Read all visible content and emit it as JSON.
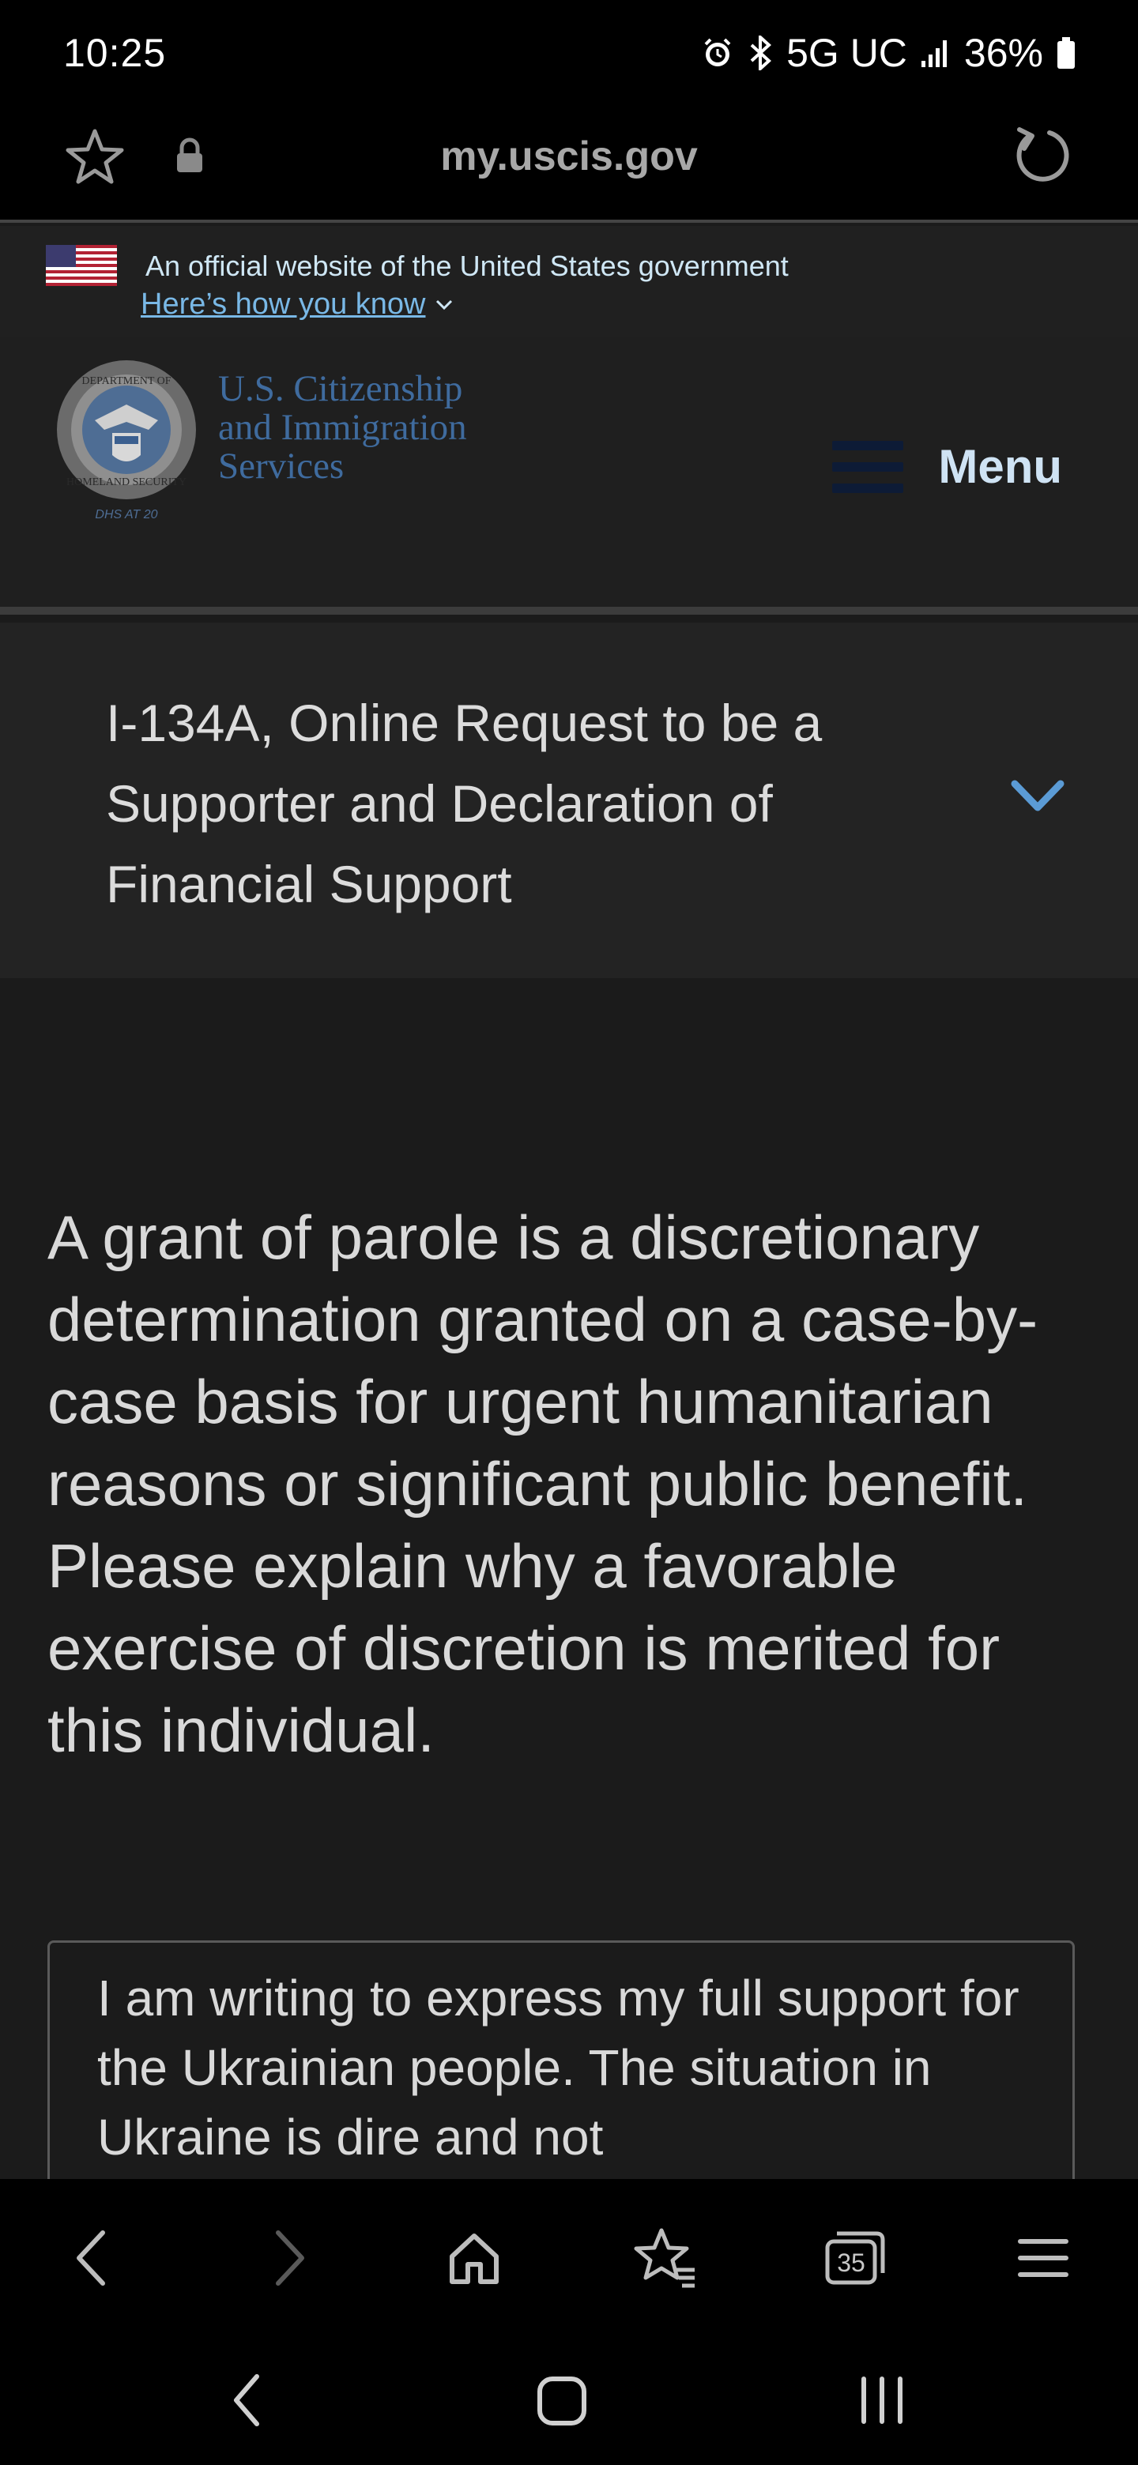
{
  "status_bar": {
    "time": "10:25",
    "network": "5G UC",
    "battery": "36%",
    "icons": [
      "alarm-icon",
      "bluetooth-icon",
      "signal-icon",
      "battery-icon"
    ]
  },
  "browser": {
    "url": "my.uscis.gov",
    "tabs_count": "35"
  },
  "gov_banner": {
    "official_text": "An official website of the United States government",
    "how_you_know": "Here’s how you know"
  },
  "header": {
    "agency_line1": "U.S. Citizenship",
    "agency_line2": "and Immigration",
    "agency_line3": "Services",
    "seal_text_top": "DEPARTMENT OF",
    "seal_text_bottom": "HOMELAND SECURITY",
    "seal_caption": "DHS AT 20",
    "menu_label": "Menu"
  },
  "form": {
    "title": "I-134A, Online Request to be a Supporter and Declaration of Financial Support",
    "question": "A grant of parole is a discretionary determination granted on a case-by-case basis for urgent humanitarian reasons or significant public benefit. Please explain why a favorable exercise of discretion is merited for this individual.",
    "answer": "I am writing to express my full support for the Ukrainian people. The situation in Ukraine is dire and not"
  },
  "colors": {
    "link": "#79b8e6",
    "menu_text": "#cfe3f4",
    "agency_text": "#3f6b9e",
    "chevron": "#5b9bd5"
  }
}
